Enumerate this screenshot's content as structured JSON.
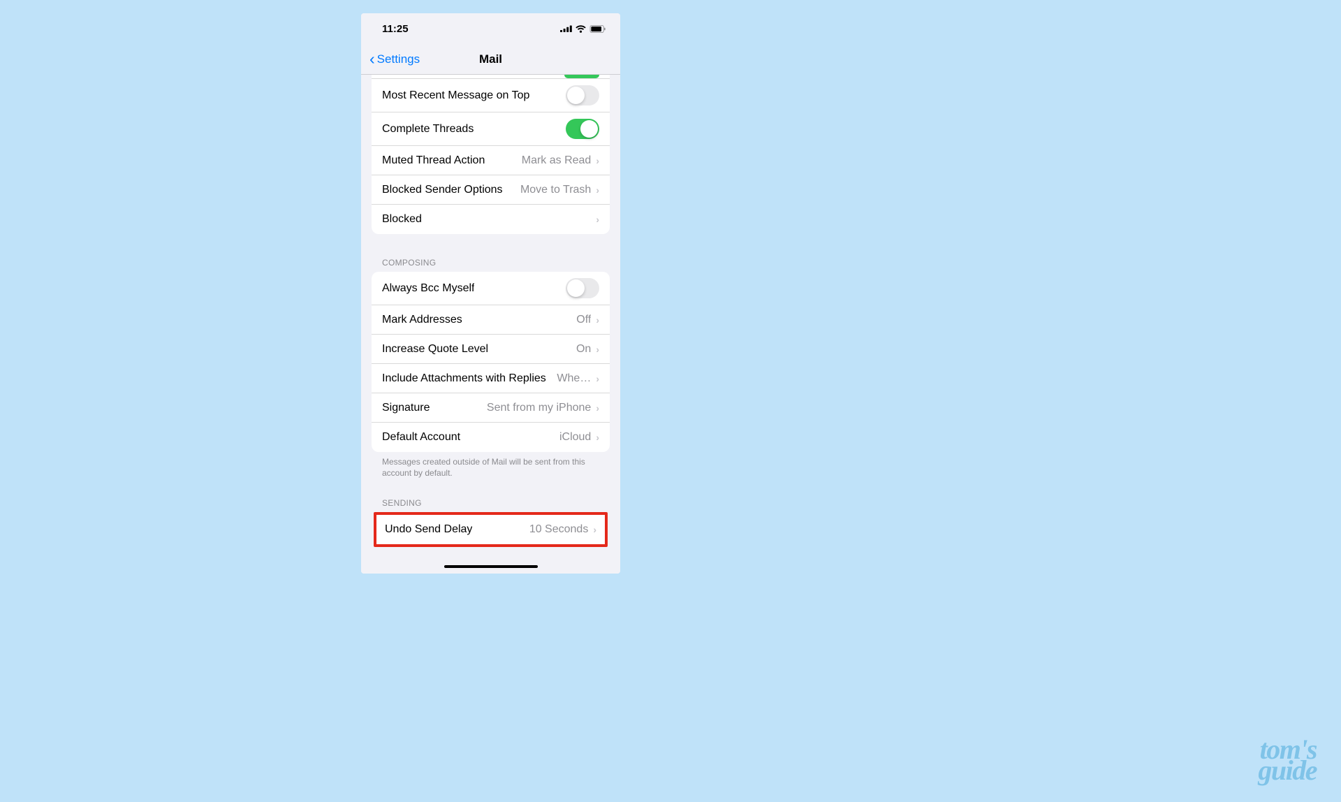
{
  "status_bar": {
    "time": "11:25"
  },
  "nav": {
    "back_label": "Settings",
    "title": "Mail"
  },
  "sections": {
    "threading": {
      "rows": {
        "most_recent_top": {
          "label": "Most Recent Message on Top",
          "toggled": false
        },
        "complete_threads": {
          "label": "Complete Threads",
          "toggled": true
        },
        "muted_thread_action": {
          "label": "Muted Thread Action",
          "value": "Mark as Read"
        },
        "blocked_sender_options": {
          "label": "Blocked Sender Options",
          "value": "Move to Trash"
        },
        "blocked": {
          "label": "Blocked"
        }
      }
    },
    "composing": {
      "header": "COMPOSING",
      "rows": {
        "always_bcc": {
          "label": "Always Bcc Myself",
          "toggled": false
        },
        "mark_addresses": {
          "label": "Mark Addresses",
          "value": "Off"
        },
        "increase_quote_level": {
          "label": "Increase Quote Level",
          "value": "On"
        },
        "include_attachments": {
          "label": "Include Attachments with Replies",
          "value": "Whe…"
        },
        "signature": {
          "label": "Signature",
          "value": "Sent from my iPhone"
        },
        "default_account": {
          "label": "Default Account",
          "value": "iCloud"
        }
      },
      "footer": "Messages created outside of Mail will be sent from this account by default."
    },
    "sending": {
      "header": "SENDING",
      "rows": {
        "undo_send_delay": {
          "label": "Undo Send Delay",
          "value": "10 Seconds"
        }
      }
    }
  },
  "watermark": {
    "line1": "tom's",
    "line2": "guide"
  },
  "colors": {
    "page_bg": "#BFE2F9",
    "accent_blue": "#007AFF",
    "toggle_green": "#34C759",
    "highlight_red": "#E4291B"
  }
}
